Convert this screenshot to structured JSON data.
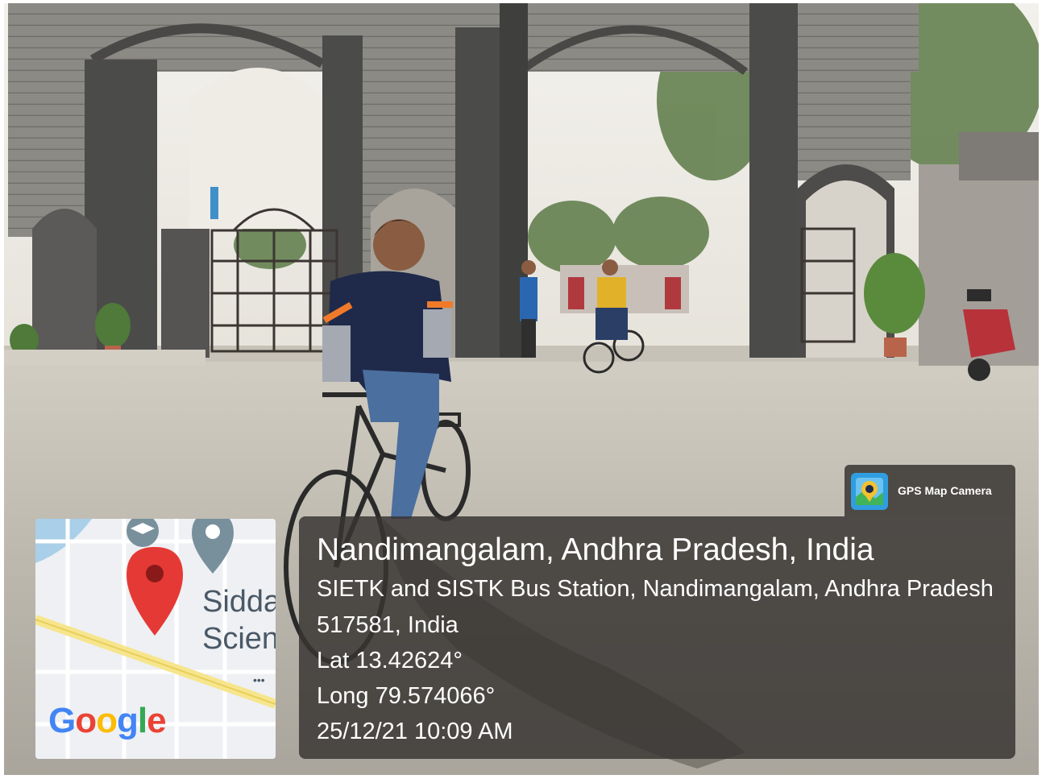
{
  "watermark": {
    "app_name": "GPS Map Camera",
    "location_title": "Nandimangalam, Andhra Pradesh, India",
    "address_line_1": "SIETK and SISTK Bus Station, Nandimangalam, Andhra Pradesh",
    "address_line_2": "517581, India",
    "latitude": "Lat 13.42624°",
    "longitude": "Long 79.574066°",
    "datetime": "25/12/21 10:09 AM"
  },
  "map": {
    "label_line_1": "Sidda",
    "label_line_2": "Scien",
    "brand": [
      "G",
      "o",
      "o",
      "g",
      "l",
      "e"
    ],
    "brand_colors": [
      "#4285F4",
      "#EA4335",
      "#FBBC05",
      "#4285F4",
      "#34A853",
      "#EA4335"
    ],
    "pin_color": "#E53935",
    "poi_color": "#78909C"
  },
  "colors": {
    "panel_bg": "#383432",
    "gate_stone": "#5f5f5f",
    "road": "#bdb9b0"
  }
}
